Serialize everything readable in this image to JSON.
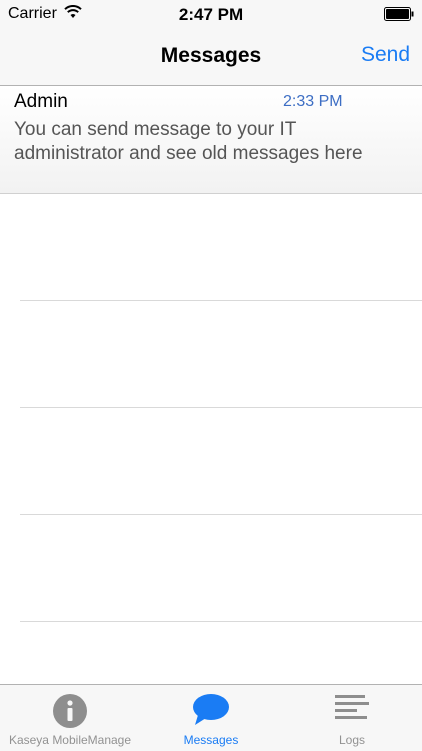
{
  "status_bar": {
    "carrier": "Carrier",
    "time": "2:47 PM"
  },
  "nav": {
    "title": "Messages",
    "send_label": "Send"
  },
  "messages": [
    {
      "sender": "Admin",
      "time": "2:33 PM",
      "body": "You can send message to your IT administrator and see old messages here"
    }
  ],
  "tabs": [
    {
      "label": "Kaseya MobileManage",
      "icon": "info-icon",
      "active": false
    },
    {
      "label": "Messages",
      "icon": "chat-bubble-icon",
      "active": true
    },
    {
      "label": "Logs",
      "icon": "list-lines-icon",
      "active": false
    }
  ],
  "colors": {
    "accent": "#1a7cf4",
    "time_text": "#3d6ec4",
    "inactive_tab": "#929292"
  }
}
